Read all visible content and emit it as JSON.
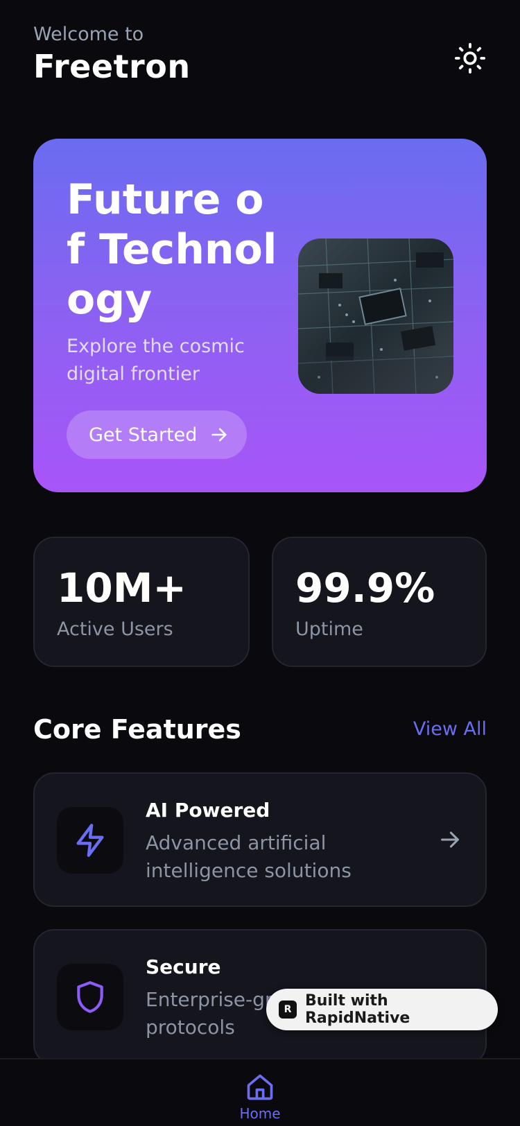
{
  "header": {
    "welcome": "Welcome to",
    "app_name": "Freetron",
    "theme_icon": "sun-icon"
  },
  "hero": {
    "title": "Future of Technology",
    "subtitle": "Explore the cosmic digital frontier",
    "cta_label": "Get Started",
    "image": "circuit-board-image",
    "gradient_top": "#6a6cf0",
    "gradient_bottom": "#a855f7"
  },
  "stats": [
    {
      "value": "10M+",
      "label": "Active Users"
    },
    {
      "value": "99.9%",
      "label": "Uptime"
    }
  ],
  "features_section": {
    "title": "Core Features",
    "view_all": "View All",
    "items": [
      {
        "title": "AI Powered",
        "description": "Advanced artificial intelligence solutions",
        "icon": "lightning-icon"
      },
      {
        "title": "Secure",
        "description": "Enterprise-grade security protocols",
        "visible_description_start": "Enterprise-gra",
        "visible_description_end": "protocols",
        "icon": "shield-icon"
      }
    ]
  },
  "badge": {
    "label": "Built with RapidNative"
  },
  "tabbar": {
    "home_label": "Home"
  },
  "colors": {
    "background": "#0a0a0e",
    "card": "#14151d",
    "accent": "#6b6ef2",
    "muted_text": "#8d95a5"
  }
}
